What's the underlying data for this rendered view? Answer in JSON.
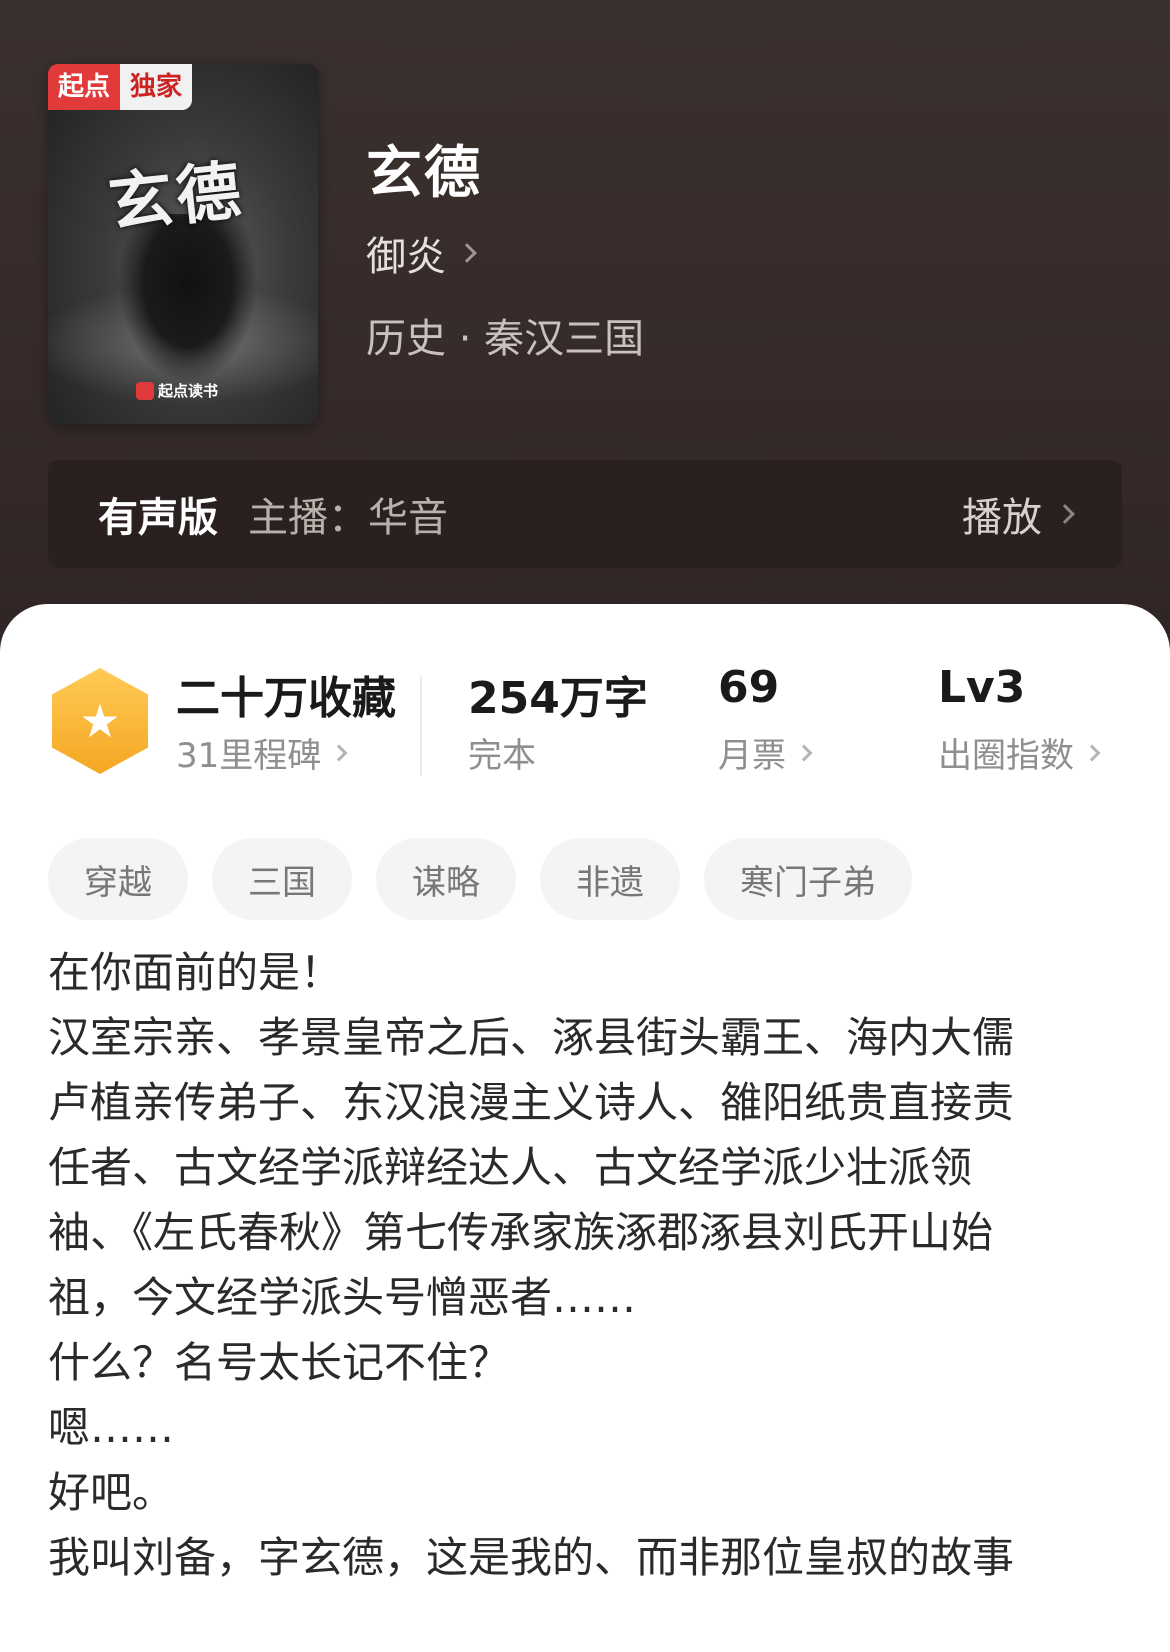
{
  "cover": {
    "badge_left": "起点",
    "badge_right": "独家",
    "art_title": "玄德",
    "publisher": "起点读书"
  },
  "book": {
    "title": "玄德",
    "author": "御炎",
    "genre": "历史 · 秦汉三国"
  },
  "audio": {
    "label": "有声版",
    "host": "主播：华音",
    "play_label": "播放"
  },
  "stats": {
    "favorites": "二十万收藏",
    "milestones": "31里程碑",
    "word_count": "254万字",
    "status": "完本",
    "monthly_votes": "69",
    "monthly_votes_label": "月票",
    "level": "Lv3",
    "level_label": "出圈指数"
  },
  "tags": [
    "穿越",
    "三国",
    "谋略",
    "非遗",
    "寒门子弟"
  ],
  "description": [
    "在你面前的是！",
    "汉室宗亲、孝景皇帝之后、涿县街头霸王、海内大儒",
    "卢植亲传弟子、东汉浪漫主义诗人、雒阳纸贵直接责",
    "任者、古文经学派辩经达人、古文经学派少壮派领",
    "袖、《左氏春秋》第七传承家族涿郡涿县刘氏开山始",
    "祖，今文经学派头号憎恶者……",
    "什么？名号太长记不住？",
    "嗯……",
    "好吧。",
    "我叫刘备，字玄德，这是我的、而非那位皇叔的故事"
  ],
  "colors": {
    "header_bg": "#362b29",
    "audio_bar_bg": "#2a2020",
    "badge_red": "#e03a3a",
    "hex_gold": "#f5a623"
  }
}
